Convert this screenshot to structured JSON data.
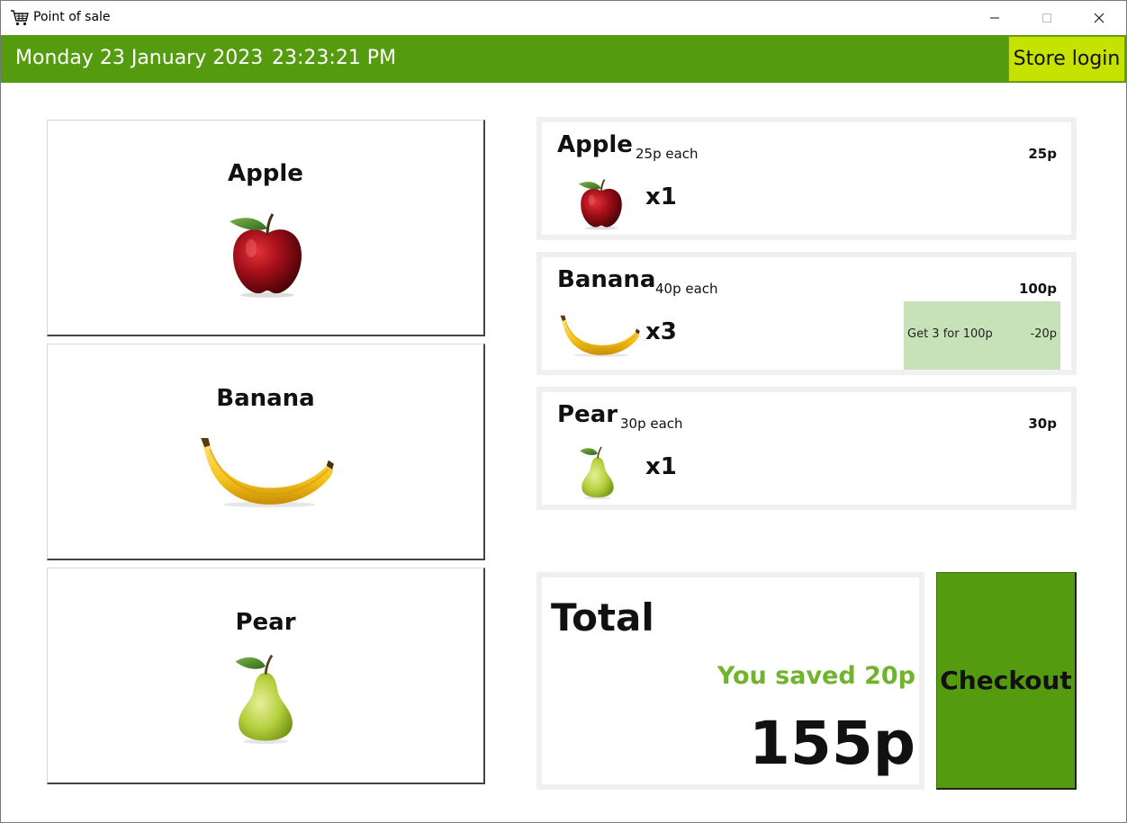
{
  "window": {
    "title": "Point of sale",
    "icon": "shopping-cart-icon",
    "controls": {
      "minimize": "minimize-icon",
      "maximize": "maximize-icon",
      "close": "close-icon"
    }
  },
  "header": {
    "date": "Monday 23 January 2023",
    "time": "23:23:21 PM",
    "login_label": "Store login",
    "bg_color": "#549b10",
    "login_color": "#c5e200"
  },
  "products": [
    {
      "name": "Apple",
      "icon": "apple-icon"
    },
    {
      "name": "Banana",
      "icon": "banana-icon"
    },
    {
      "name": "Pear",
      "icon": "pear-icon"
    }
  ],
  "cart": [
    {
      "name": "Apple",
      "each": "25p each",
      "price": "25p",
      "qty": "x1",
      "icon": "apple-icon"
    },
    {
      "name": "Banana",
      "each": "40p each",
      "price": "100p",
      "qty": "x3",
      "icon": "banana-icon",
      "offer": {
        "label": "Get 3 for 100p",
        "amount": "-20p"
      }
    },
    {
      "name": "Pear",
      "each": "30p each",
      "price": "30p",
      "qty": "x1",
      "icon": "pear-icon"
    }
  ],
  "total": {
    "label": "Total",
    "saved": "You saved 20p",
    "amount": "155p",
    "saved_color": "#70b32d"
  },
  "checkout_label": "Checkout",
  "offer_color": "#c7e2b9"
}
